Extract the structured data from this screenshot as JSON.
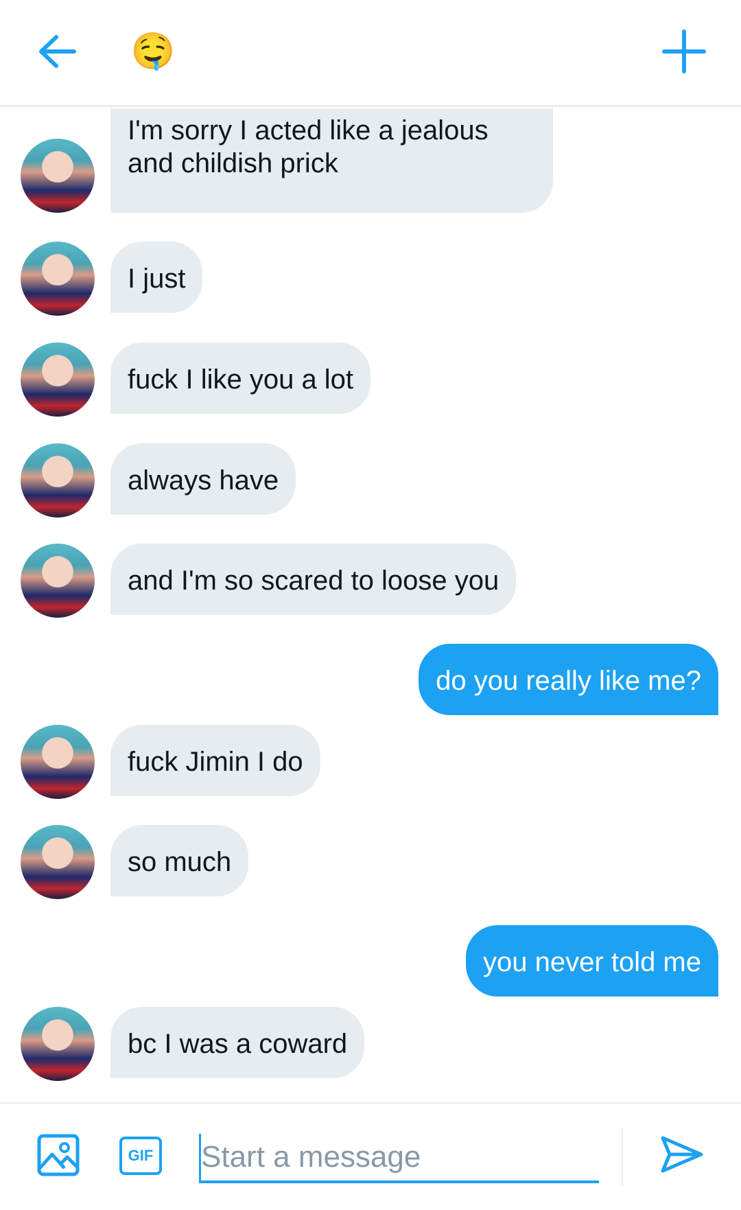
{
  "header": {
    "title_emoji": "🤤",
    "back_icon": "back-arrow-icon",
    "add_icon": "plus-icon"
  },
  "messages": [
    {
      "from": "them",
      "text": "I'm sorry I acted like a jealous\nand childish prick"
    },
    {
      "from": "them",
      "text": "I just"
    },
    {
      "from": "them",
      "text": "fuck I like you a lot"
    },
    {
      "from": "them",
      "text": "always have"
    },
    {
      "from": "them",
      "text": "and I'm so scared to loose you"
    },
    {
      "from": "me",
      "text": "do you really like me?"
    },
    {
      "from": "them",
      "text": "fuck Jimin I do"
    },
    {
      "from": "them",
      "text": "so much"
    },
    {
      "from": "me",
      "text": "you never told me"
    },
    {
      "from": "them",
      "text": "bc I was a coward"
    }
  ],
  "composer": {
    "placeholder": "Start a message",
    "gif_label": "GIF",
    "media_icon": "image-icon",
    "send_icon": "send-icon"
  },
  "colors": {
    "accent": "#1da1f2",
    "received_bubble": "#e6ecf0"
  }
}
